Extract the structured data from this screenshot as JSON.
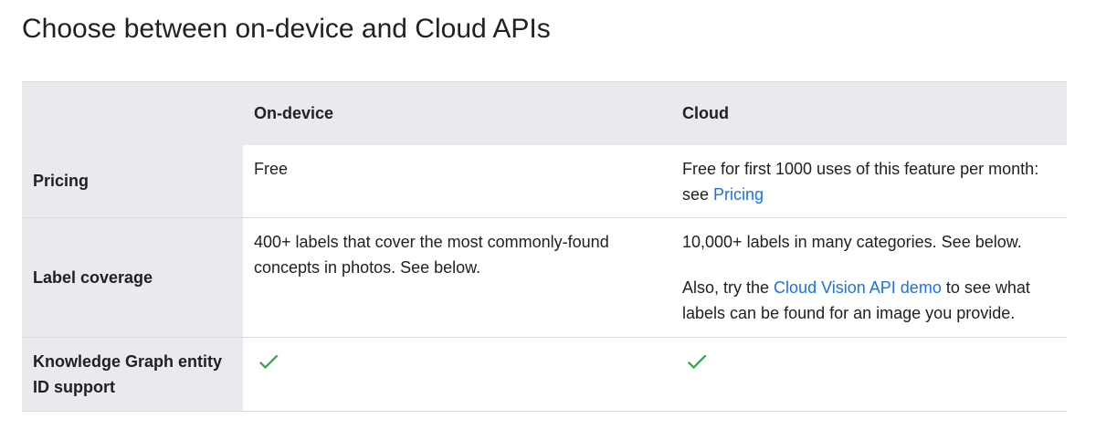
{
  "page": {
    "title": "Choose between on-device and Cloud APIs"
  },
  "table": {
    "headers": [
      "",
      "On-device",
      "Cloud"
    ],
    "rows": [
      {
        "label": "Pricing",
        "on_device": "Free",
        "cloud_text": "Free for first 1000 uses of this feature per month: see ",
        "cloud_link": "Pricing"
      },
      {
        "label": "Label coverage",
        "on_device": "400+ labels that cover the most commonly-found concepts in photos. See below.",
        "cloud_p1": "10,000+ labels in many categories. See below.",
        "cloud_p2_before": "Also, try the ",
        "cloud_p2_link": "Cloud Vision API demo",
        "cloud_p2_after": " to see what labels can be found for an image you provide."
      },
      {
        "label": "Knowledge Graph entity ID support",
        "on_device_icon": "check-icon",
        "cloud_icon": "check-icon"
      }
    ]
  },
  "colors": {
    "header_bg": "#e8eaed",
    "link": "#1a73e8",
    "check": "#34a853",
    "border": "#dadce0",
    "text": "#202124"
  }
}
